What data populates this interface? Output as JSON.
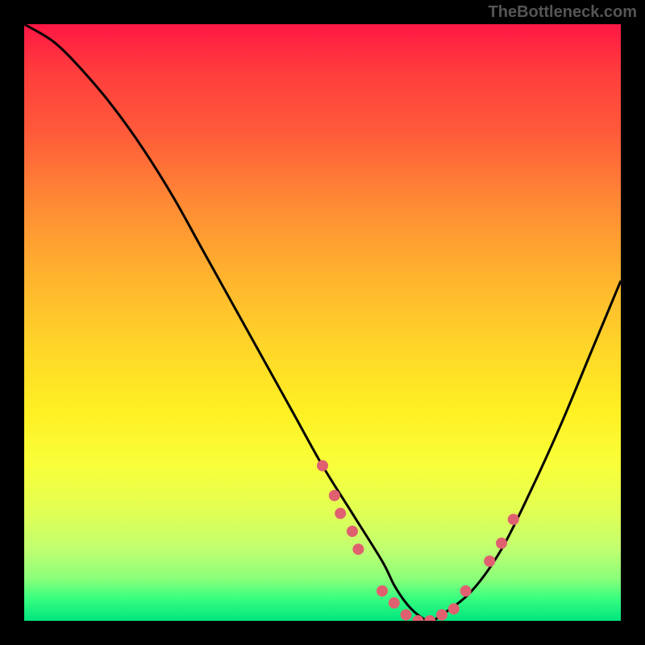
{
  "watermark": "TheBottleneck.com",
  "chart_data": {
    "type": "line",
    "title": "",
    "xlabel": "",
    "ylabel": "",
    "xlim": [
      0,
      100
    ],
    "ylim": [
      0,
      100
    ],
    "background": "red-yellow-green vertical gradient (bottleneck heatmap)",
    "series": [
      {
        "name": "bottleneck-curve",
        "color": "#000000",
        "x": [
          0,
          5,
          10,
          15,
          20,
          25,
          30,
          35,
          40,
          45,
          50,
          55,
          60,
          62,
          64,
          66,
          68,
          70,
          75,
          80,
          85,
          90,
          95,
          100
        ],
        "y": [
          100,
          97,
          92,
          86,
          79,
          71,
          62,
          53,
          44,
          35,
          26,
          18,
          10,
          6,
          3,
          1,
          0,
          1,
          5,
          12,
          22,
          33,
          45,
          57
        ]
      }
    ],
    "markers": [
      {
        "x": 50,
        "y": 26
      },
      {
        "x": 52,
        "y": 21
      },
      {
        "x": 53,
        "y": 18
      },
      {
        "x": 55,
        "y": 15
      },
      {
        "x": 56,
        "y": 12
      },
      {
        "x": 60,
        "y": 5
      },
      {
        "x": 62,
        "y": 3
      },
      {
        "x": 64,
        "y": 1
      },
      {
        "x": 66,
        "y": 0
      },
      {
        "x": 68,
        "y": 0
      },
      {
        "x": 70,
        "y": 1
      },
      {
        "x": 72,
        "y": 2
      },
      {
        "x": 74,
        "y": 5
      },
      {
        "x": 78,
        "y": 10
      },
      {
        "x": 80,
        "y": 13
      },
      {
        "x": 82,
        "y": 17
      }
    ],
    "marker_color": "#e06070"
  }
}
